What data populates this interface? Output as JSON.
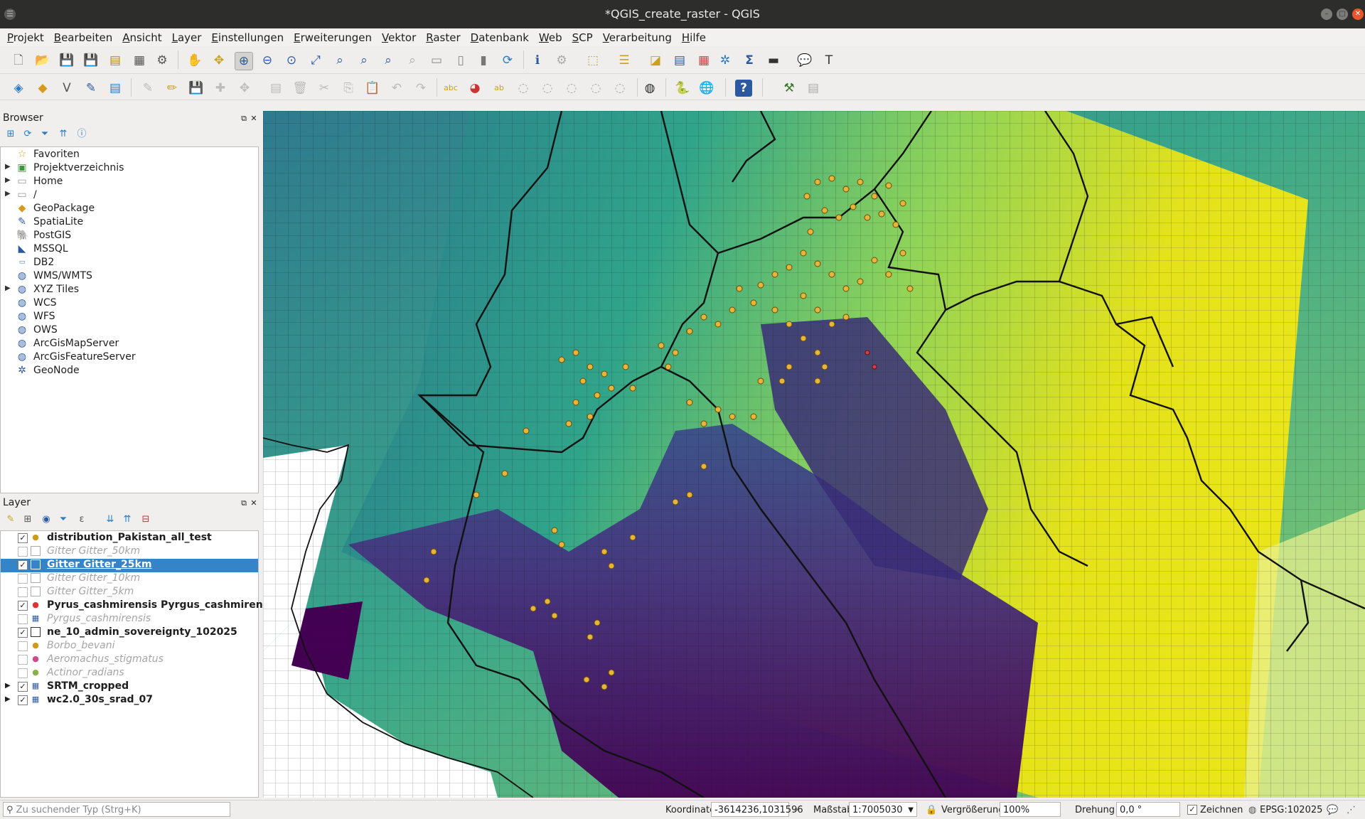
{
  "window": {
    "title": "*QGIS_create_raster - QGIS"
  },
  "menu": [
    "Projekt",
    "Bearbeiten",
    "Ansicht",
    "Layer",
    "Einstellungen",
    "Erweiterungen",
    "Vektor",
    "Raster",
    "Datenbank",
    "Web",
    "SCP",
    "Verarbeitung",
    "Hilfe"
  ],
  "browser": {
    "title": "Browser",
    "items": [
      {
        "label": "Favoriten",
        "icon": "star-icon",
        "expandable": false
      },
      {
        "label": "Projektverzeichnis",
        "icon": "project-folder-icon",
        "expandable": true
      },
      {
        "label": "Home",
        "icon": "folder-icon",
        "expandable": true
      },
      {
        "label": "/",
        "icon": "folder-icon",
        "expandable": true
      },
      {
        "label": "GeoPackage",
        "icon": "geopackage-icon",
        "expandable": false
      },
      {
        "label": "SpatiaLite",
        "icon": "spatialite-icon",
        "expandable": false
      },
      {
        "label": "PostGIS",
        "icon": "postgis-icon",
        "expandable": false
      },
      {
        "label": "MSSQL",
        "icon": "mssql-icon",
        "expandable": false
      },
      {
        "label": "DB2",
        "icon": "db2-icon",
        "expandable": false
      },
      {
        "label": "WMS/WMTS",
        "icon": "globe-icon",
        "expandable": false
      },
      {
        "label": "XYZ Tiles",
        "icon": "globe-icon",
        "expandable": true
      },
      {
        "label": "WCS",
        "icon": "globe-icon",
        "expandable": false
      },
      {
        "label": "WFS",
        "icon": "globe-icon",
        "expandable": false
      },
      {
        "label": "OWS",
        "icon": "globe-icon",
        "expandable": false
      },
      {
        "label": "ArcGisMapServer",
        "icon": "globe-icon",
        "expandable": false
      },
      {
        "label": "ArcGisFeatureServer",
        "icon": "globe-icon",
        "expandable": false
      },
      {
        "label": "GeoNode",
        "icon": "geonode-icon",
        "expandable": false
      }
    ]
  },
  "layers": {
    "title": "Layer",
    "items": [
      {
        "label": "distribution_Pakistan_all_test",
        "checked": true,
        "style": "bold",
        "icon": "point-orange",
        "expandable": false,
        "selected": false
      },
      {
        "label": "Gitter Gitter_50km",
        "checked": false,
        "style": "dim",
        "icon": "polygon-empty",
        "expandable": false,
        "selected": false
      },
      {
        "label": "Gitter Gitter_25km",
        "checked": true,
        "style": "bold",
        "icon": "polygon-blue",
        "expandable": false,
        "selected": true
      },
      {
        "label": "Gitter Gitter_10km",
        "checked": false,
        "style": "dim",
        "icon": "polygon-empty",
        "expandable": false,
        "selected": false
      },
      {
        "label": "Gitter Gitter_5km",
        "checked": false,
        "style": "dim",
        "icon": "polygon-empty",
        "expandable": false,
        "selected": false
      },
      {
        "label": "Pyrus_cashmirensis Pyrgus_cashmirensis",
        "checked": true,
        "style": "bold",
        "icon": "point-red",
        "expandable": false,
        "selected": false
      },
      {
        "label": "Pyrgus_cashmirensis",
        "checked": false,
        "style": "dim",
        "icon": "raster",
        "expandable": false,
        "selected": false
      },
      {
        "label": "ne_10_admin_sovereignty_102025",
        "checked": true,
        "style": "bold",
        "icon": "polygon-empty",
        "expandable": false,
        "selected": false
      },
      {
        "label": "Borbo_bevani",
        "checked": false,
        "style": "dim",
        "icon": "point-orange",
        "expandable": false,
        "selected": false
      },
      {
        "label": "Aeromachus_stigmatus",
        "checked": false,
        "style": "dim",
        "icon": "point-pink",
        "expandable": false,
        "selected": false
      },
      {
        "label": "Actinor_radians",
        "checked": false,
        "style": "dim",
        "icon": "point-green",
        "expandable": false,
        "selected": false
      },
      {
        "label": "SRTM_cropped",
        "checked": true,
        "style": "bold",
        "icon": "raster",
        "expandable": true,
        "selected": false
      },
      {
        "label": "wc2.0_30s_srad_07",
        "checked": true,
        "style": "bold",
        "icon": "raster",
        "expandable": true,
        "selected": false
      }
    ]
  },
  "status": {
    "search_placeholder": "Zu suchender Typ (Strg+K)",
    "coord_label": "Koordinate",
    "coord_value": "-3614236,1031596",
    "scale_label": "Maßstab",
    "scale_value": "1:7005030",
    "magnifier_label": "Vergrößerung",
    "magnifier_value": "100%",
    "rotation_label": "Drehung",
    "rotation_value": "0,0 °",
    "render_label": "Zeichnen",
    "crs_label": "EPSG:102025"
  },
  "colors": {
    "selection": "#3584c8",
    "point_fill": "#e6b53a",
    "raster_dark": "#440154",
    "raster_mid": "#21918c",
    "raster_high": "#fde725"
  }
}
